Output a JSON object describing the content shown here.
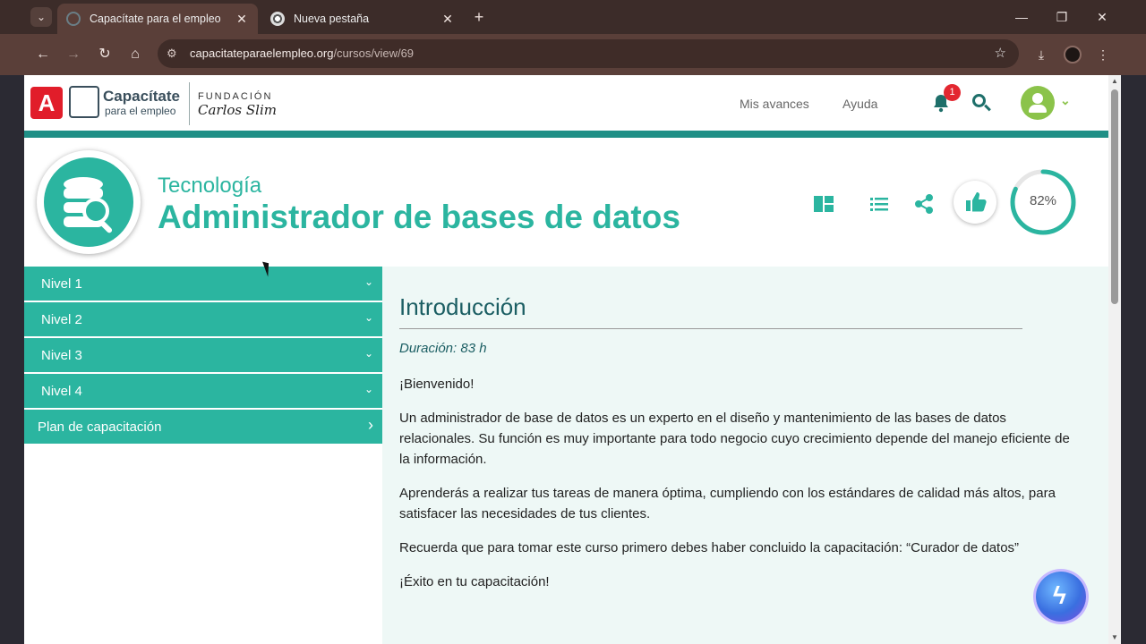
{
  "browser": {
    "tabs": [
      {
        "title": "Capacítate para el empleo",
        "active": true
      },
      {
        "title": "Nueva pestaña",
        "active": false
      }
    ],
    "new_tab_symbol": "+",
    "url_host": "capacitateparaelempleo.org",
    "url_path": "/cursos/view/69"
  },
  "header": {
    "logo_a": "A",
    "logo_title": "Capacítate",
    "logo_subtitle": "para el empleo",
    "foundation_line1": "FUNDACIÓN",
    "foundation_line2": "Carlos Slim",
    "nav": [
      "Mis avances",
      "Ayuda"
    ],
    "notification_count": "1"
  },
  "course": {
    "category": "Tecnología",
    "title": "Administrador de bases de datos",
    "progress_label": "82%",
    "progress_value": 0.82,
    "accent_color": "#2bb5a0"
  },
  "sidebar": {
    "items": [
      {
        "label": "Nivel 1",
        "chevron": "⌄"
      },
      {
        "label": "Nivel 2",
        "chevron": "⌄"
      },
      {
        "label": "Nivel 3",
        "chevron": "⌄"
      },
      {
        "label": "Nivel 4",
        "chevron": "⌄"
      },
      {
        "label": "Plan de capacitación",
        "chevron": "›"
      }
    ]
  },
  "content": {
    "heading": "Introducción",
    "duration": "Duración: 83 h",
    "paragraphs": [
      "¡Bienvenido!",
      "Un administrador de base de datos es un experto en el diseño y mantenimiento de las bases de datos relacionales. Su función es muy importante para todo negocio cuyo crecimiento depende del manejo eficiente de la información.",
      "Aprenderás a realizar tus tareas de manera óptima, cumpliendo con los estándares de calidad más altos, para satisfacer las necesidades de tus clientes.",
      "Recuerda que para tomar este curso primero debes haber concluido la capacitación: “Curador de datos”",
      "¡Éxito en tu capacitación!"
    ]
  }
}
